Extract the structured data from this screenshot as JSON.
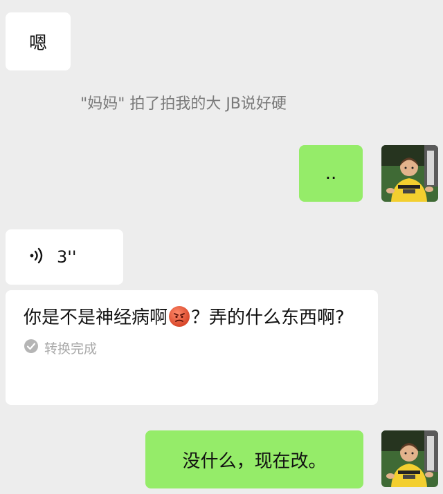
{
  "messages": {
    "msg1_text": "嗯",
    "system_text": "\"妈妈\" 拍了拍我的大 JB说好硬",
    "msg2_text": "..",
    "voice_duration": "3''",
    "transcript_part1": "你是不是神经病啊",
    "transcript_part2": "？弄的什么东西啊?",
    "transcript_status": "转换完成",
    "msg3_text": "没什么，现在改。"
  },
  "icons": {
    "voice": "voice-wave-icon",
    "status": "check-circle-icon",
    "emoji": "angry-face-emoji"
  },
  "colors": {
    "background": "#ededed",
    "incoming_bubble": "#ffffff",
    "outgoing_bubble": "#95ec69",
    "system_text": "#7a7a7a",
    "status_text": "#a8a8a8"
  }
}
